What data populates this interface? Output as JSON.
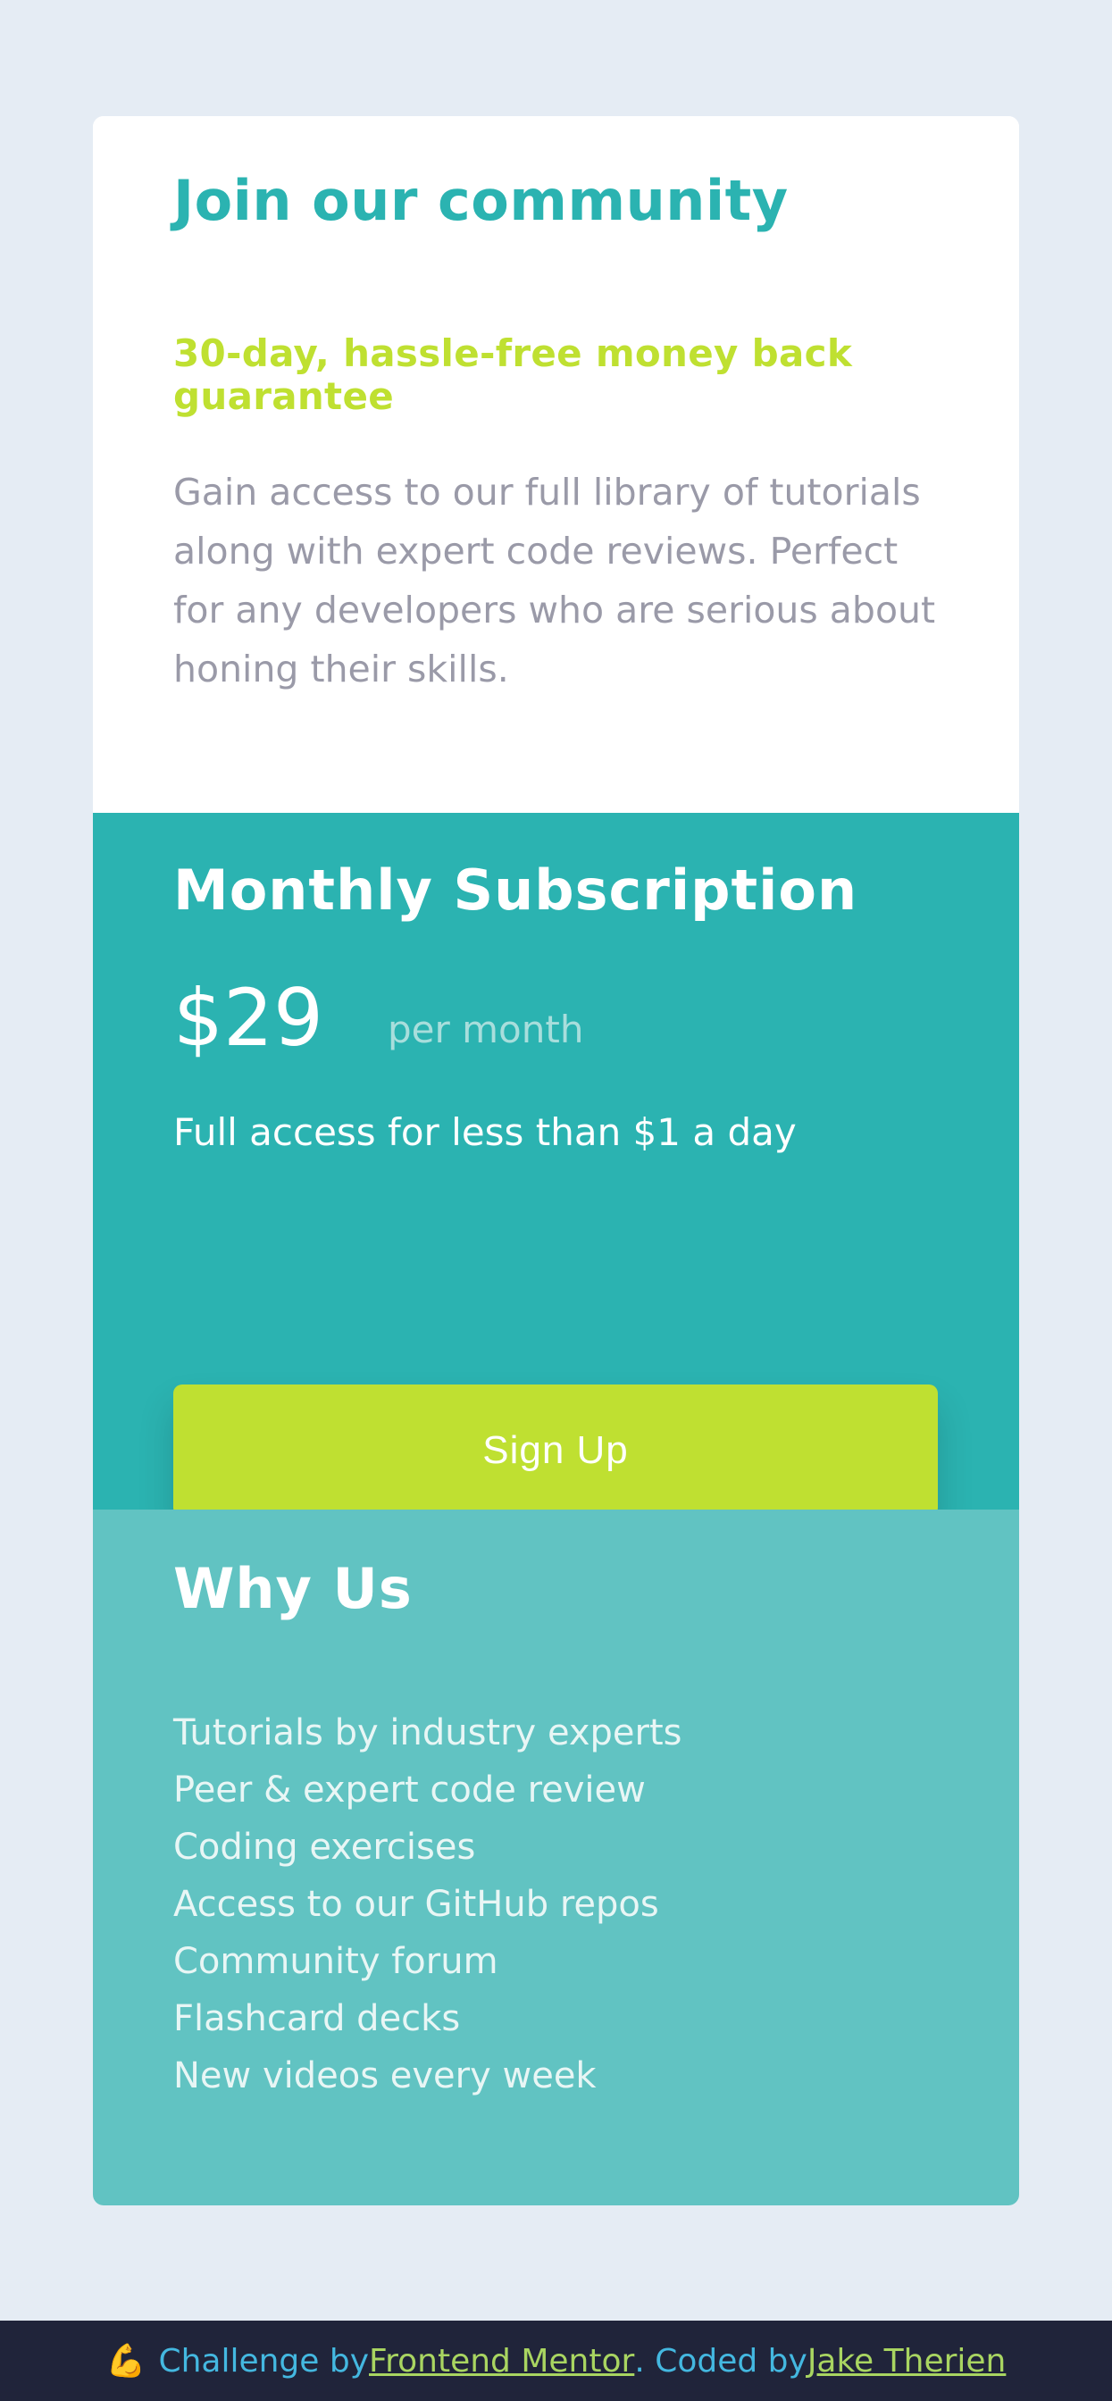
{
  "card": {
    "title": "Join our community",
    "guarantee": "30-day, hassle-free money back guarantee",
    "description": "Gain access to our full library of tutorials along with expert code reviews. Perfect for any developers who are serious about honing their skills."
  },
  "subscription": {
    "title": "Monthly Subscription",
    "price": "$29",
    "period": "per month",
    "access_note": "Full access for less than $1 a day",
    "signup_label": "Sign Up"
  },
  "why_us": {
    "title": "Why Us",
    "items": [
      "Tutorials by industry experts",
      "Peer & expert code review",
      "Coding exercises",
      "Access to our GitHub repos",
      "Community forum",
      "Flashcard decks",
      "New videos every week"
    ]
  },
  "footer": {
    "icon": "flexed-arm-icon",
    "challenge_prefix": "Challenge by ",
    "challenge_link": "Frontend Mentor",
    "coded_prefix": ". Coded by ",
    "author_link": "Jake Therien"
  },
  "colors": {
    "background": "#e5ecf4",
    "title_teal": "#2bb3b1",
    "accent_lime": "#bfe031",
    "subscription_bg": "#2bb3b1",
    "why_bg": "#61c3c2",
    "footer_bg": "#20243a"
  }
}
